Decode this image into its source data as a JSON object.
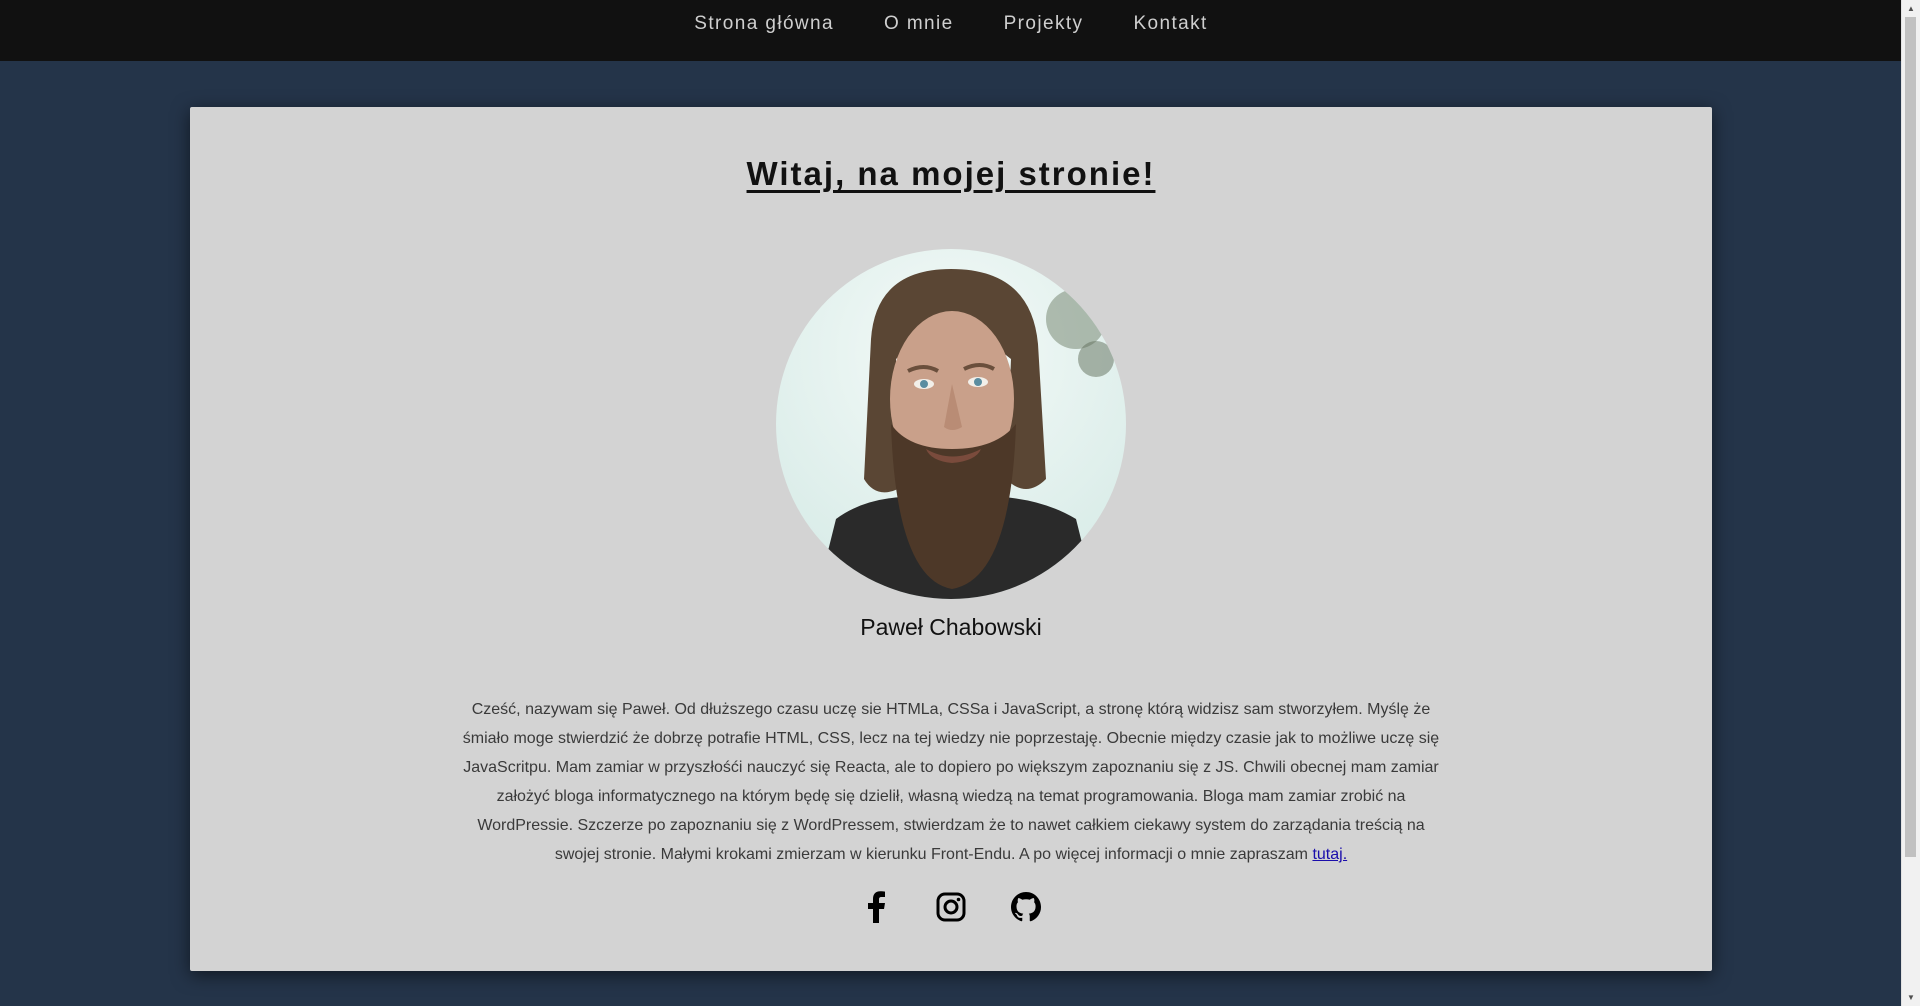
{
  "nav": {
    "items": [
      {
        "label": "Strona główna"
      },
      {
        "label": "O mnie"
      },
      {
        "label": "Projekty"
      },
      {
        "label": "Kontakt"
      }
    ]
  },
  "main": {
    "title": "Witaj, na mojej stronie!",
    "name": "Paweł Chabowski",
    "bio": "Cześć, nazywam się Paweł. Od dłuższego czasu uczę sie HTMLa, CSSa i JavaScript, a stronę którą widzisz sam stworzyłem. Myślę że śmiało moge stwierdzić że dobrzę potrafie HTML, CSS, lecz na tej wiedzy nie poprzestaję. Obecnie między czasie jak to możliwe uczę się JavaScritpu. Mam zamiar w przyszłośći nauczyć się Reacta, ale to dopiero po większym zapoznaniu się z JS. Chwili obecnej mam zamiar założyć bloga informatycznego na którym będę się dzielił, własną wiedzą na temat programowania. Bloga mam zamiar zrobić na WordPressie. Szczerze po zapoznaniu się z WordPressem, stwierdzam że to nawet całkiem ciekawy system do zarządania treścią na swojej stronie. Małymi krokami zmierzam w kierunku Front-Endu. A po więcej informacji o mnie zapraszam ",
    "bio_link": "tutaj.",
    "socials": [
      {
        "icon": "facebook-icon"
      },
      {
        "icon": "instagram-icon"
      },
      {
        "icon": "github-icon"
      }
    ]
  },
  "colors": {
    "page_bg": "#243449",
    "nav_bg": "#111111",
    "card_bg": "#d3d3d3",
    "link": "#1a0dab"
  }
}
